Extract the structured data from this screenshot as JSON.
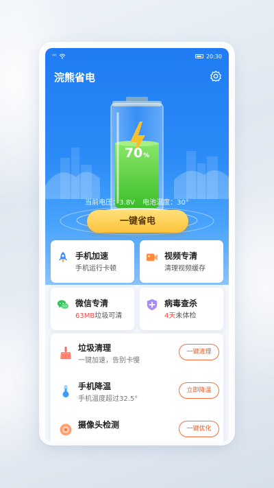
{
  "status_bar": {
    "signal": "ⁿˡ ⁿˡ",
    "time": "20:30"
  },
  "header": {
    "title": "浣熊省电"
  },
  "battery": {
    "percent": "70",
    "percent_sign": "%"
  },
  "info": {
    "voltage": "当前电压：3.8V",
    "temperature": "电池温度：30°"
  },
  "main_button": {
    "label": "一键省电"
  },
  "cards": [
    {
      "title": "手机加速",
      "subtitle": "手机运行卡顿"
    },
    {
      "title": "视频专清",
      "subtitle": "清理视频缓存"
    },
    {
      "title": "微信专清",
      "subtitle_highlight": "63MB",
      "subtitle_rest": "垃圾可清"
    },
    {
      "title": "病毒查杀",
      "subtitle_highlight": "4天",
      "subtitle_rest": "未体检"
    }
  ],
  "list": [
    {
      "title": "垃圾清理",
      "subtitle": "一键加速，告别卡慢",
      "button": "一键清理"
    },
    {
      "title": "手机降温",
      "subtitle": "手机温度超过32.5°",
      "button": "立即降温"
    },
    {
      "title": "摄像头检测",
      "subtitle": "",
      "button": "一键优化"
    }
  ],
  "colors": {
    "primary": "#1f7cf3",
    "accent_orange": "#f05a22",
    "warning_red": "#f24b4b",
    "button_yellow": "#fcc23a",
    "battery_green": "#5cd23e"
  },
  "icons": [
    "gear-icon",
    "rocket-icon",
    "video-icon",
    "wechat-icon",
    "shield-icon",
    "broom-icon",
    "thermometer-icon",
    "camera-icon",
    "lightning-icon"
  ]
}
